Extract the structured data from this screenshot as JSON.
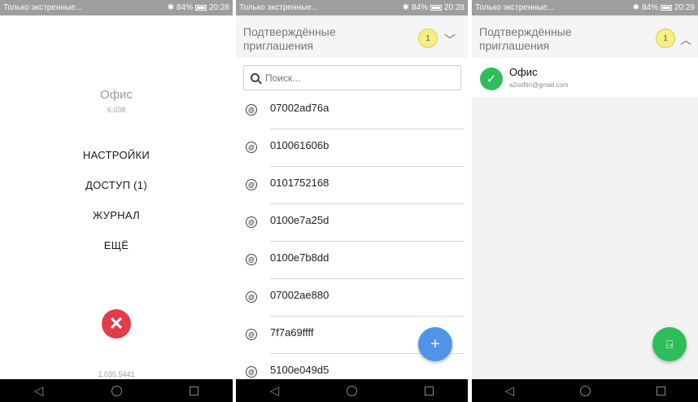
{
  "panel1": {
    "status": {
      "text": "Только экстренные...",
      "battery": "84%",
      "time": "20:28"
    },
    "title": "Офис",
    "subtitle": "6.038",
    "menu": [
      "НАСТРОЙКИ",
      "ДОСТУП (1)",
      "ЖУРНАЛ",
      "ЕЩЁ"
    ],
    "version": "1.035.5441"
  },
  "panel2": {
    "status": {
      "text": "Только экстренные...",
      "battery": "84%",
      "time": "20:28"
    },
    "header_title": "Подтверждённые приглашения",
    "badge": "1",
    "search_placeholder": "Поиск...",
    "items": [
      "07002ad76a",
      "010061606b",
      "0101752168",
      "0100e7a25d",
      "0100e7b8dd",
      "07002ae880",
      "7f7a69ffff",
      "5100e049d5"
    ],
    "fab_label": "+"
  },
  "panel3": {
    "status": {
      "text": "Только экстренные...",
      "battery": "84%",
      "time": "20:29"
    },
    "header_title": "Подтверждённые приглашения",
    "badge": "1",
    "account": {
      "name": "Офис",
      "email": "a2softin@gmail.com"
    }
  },
  "colors": {
    "close": "#e23c4a",
    "fab_blue": "#4f94e8",
    "fab_green": "#2ebd5a",
    "badge": "#f6ef86"
  },
  "icons": [
    "close-icon",
    "search-icon",
    "chevron-down-icon",
    "chevron-up-icon",
    "check-icon",
    "plus-icon",
    "exit-door-icon",
    "tag-icon"
  ]
}
